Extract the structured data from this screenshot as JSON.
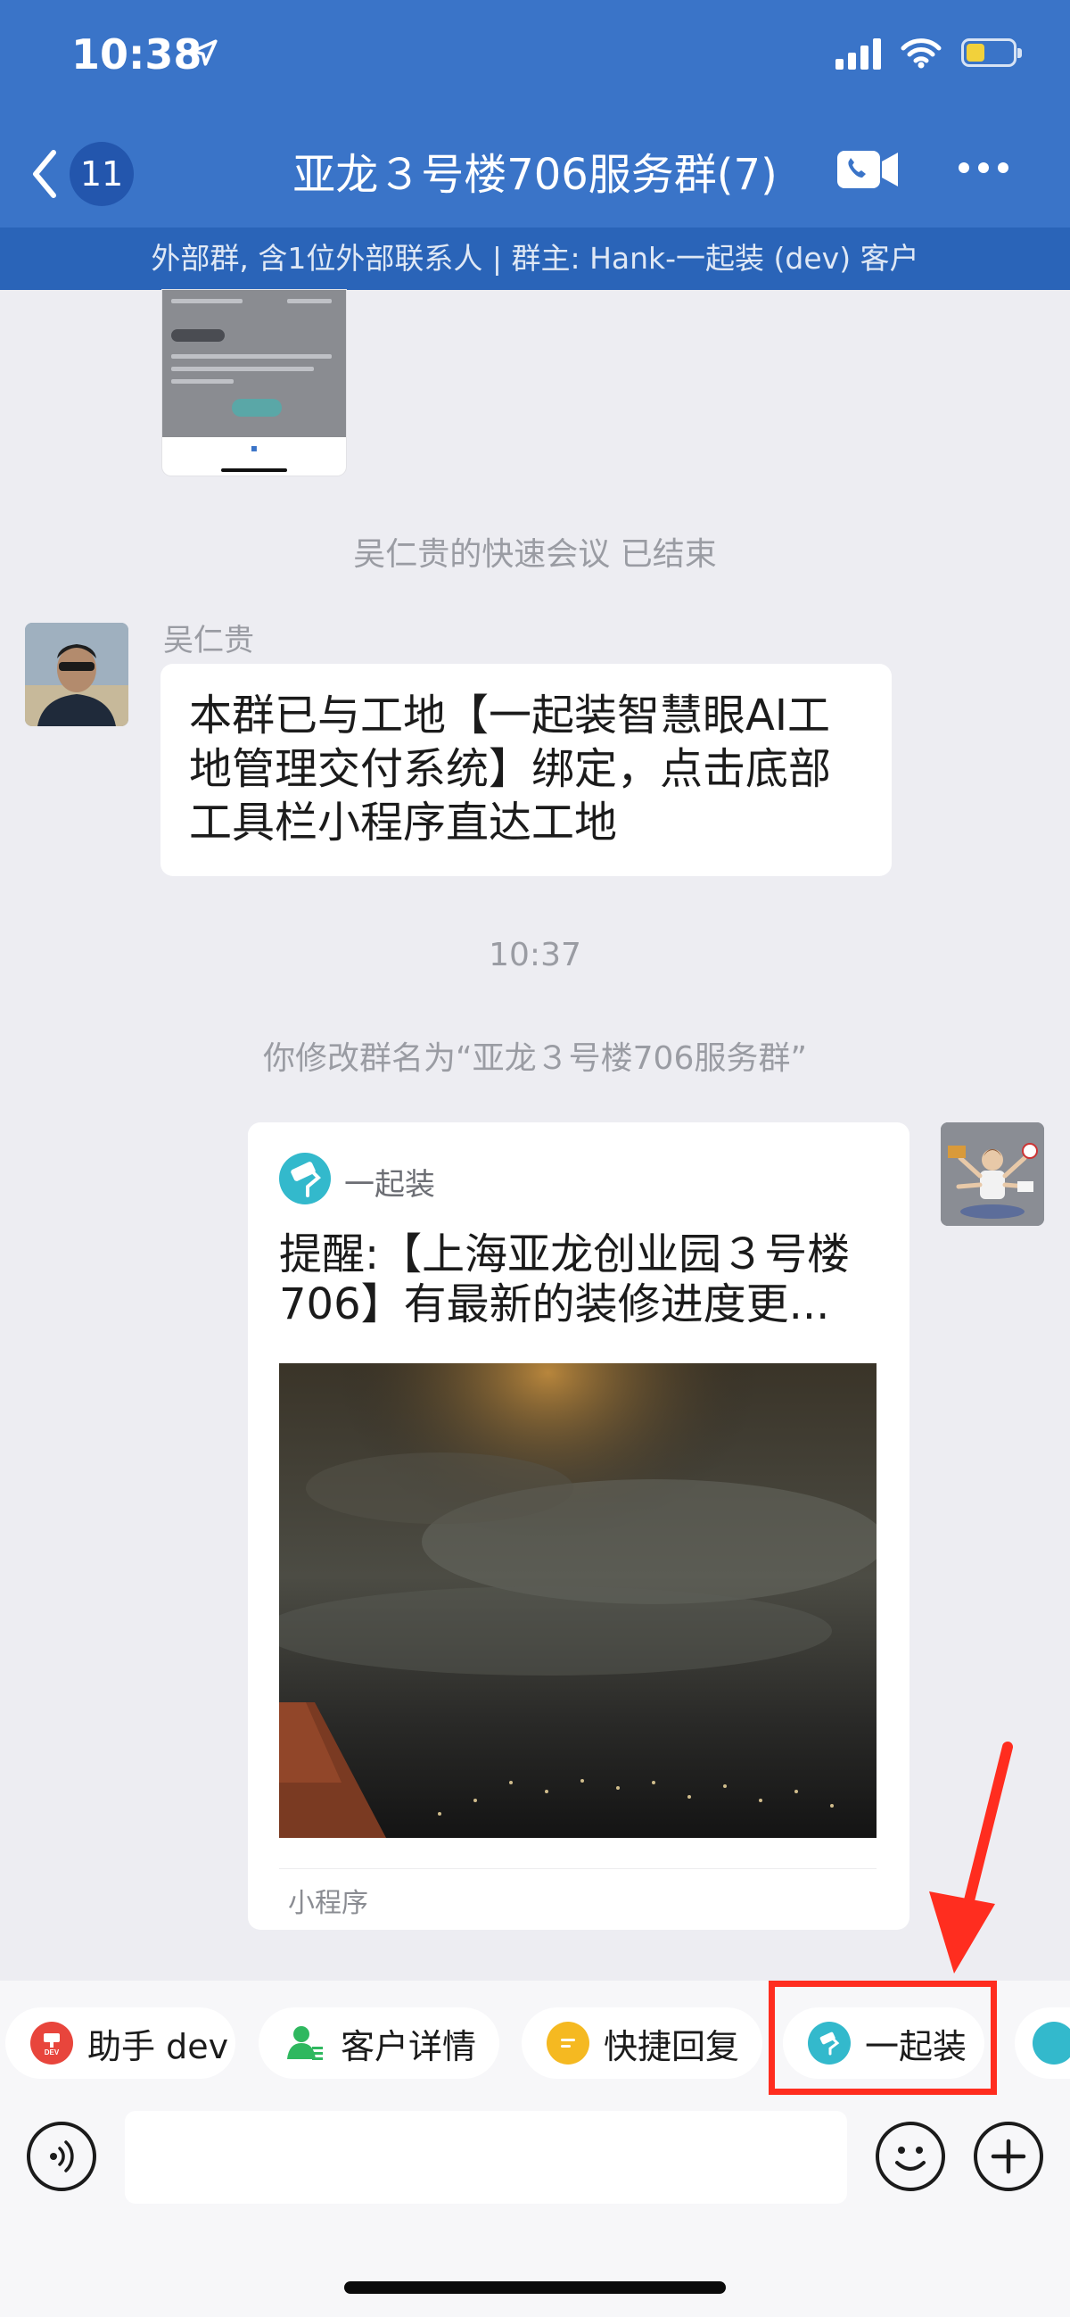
{
  "status_bar": {
    "time": "10:38"
  },
  "header": {
    "back_badge": "11",
    "title": "亚龙３号楼706服务群(7)",
    "subtitle": "外部群, 含1位外部联系人 | 群主: Hank-一起装 (dev) 客户"
  },
  "messages": {
    "system_meeting": "吴仁贵的快速会议 已结束",
    "sender_name": "吴仁贵",
    "bubble_text": "本群已与工地【一起装智慧眼AI工地管理交付系统】绑定，点击底部工具栏小程序直达工地",
    "timestamp": "10:37",
    "system_rename": "你修改群名为“亚龙３号楼706服务群”"
  },
  "mini_program_card": {
    "app_name": "一起装",
    "title": "提醒:【上海亚龙创业园３号楼706】有最新的装修进度更...",
    "footer": "小程序"
  },
  "toolbar": {
    "chips": [
      {
        "label": "助手 dev",
        "color": "#e8453c"
      },
      {
        "label": "客户详情",
        "color": "#2fb85f"
      },
      {
        "label": "快捷回复",
        "color": "#f5b921"
      },
      {
        "label": "一起装",
        "color": "#33b9cc"
      }
    ],
    "highlight_color": "#ff2d1f"
  },
  "input": {
    "placeholder": ""
  },
  "colors": {
    "header_blue": "#3a74c8",
    "subbar_blue": "#2a64b8",
    "chat_bg": "#ededf2"
  }
}
